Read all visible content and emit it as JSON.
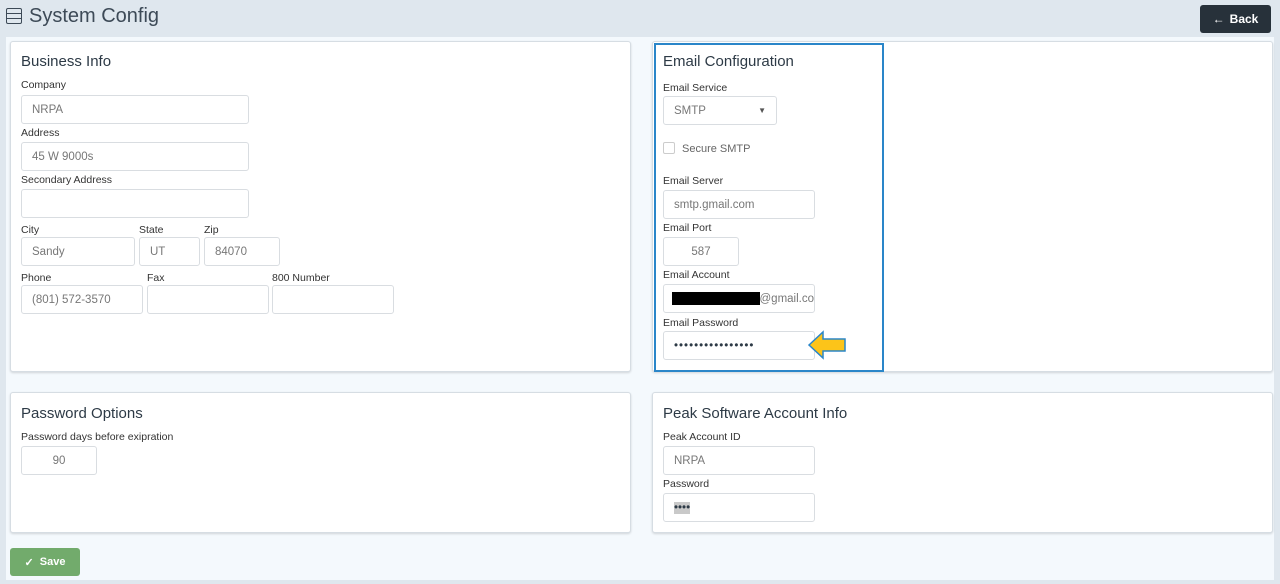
{
  "header": {
    "title": "System Config",
    "back_label": "Back"
  },
  "business": {
    "title": "Business Info",
    "company_label": "Company",
    "company": "NRPA",
    "address_label": "Address",
    "address": "45 W 9000s",
    "secondary_label": "Secondary Address",
    "secondary": "",
    "city_label": "City",
    "city": "Sandy",
    "state_label": "State",
    "state": "UT",
    "zip_label": "Zip",
    "zip": "84070",
    "phone_label": "Phone",
    "phone": "(801) 572-3570",
    "fax_label": "Fax",
    "fax": "",
    "toll_label": "800 Number",
    "toll": ""
  },
  "email": {
    "title": "Email Configuration",
    "service_label": "Email Service",
    "service": "SMTP",
    "secure_label": "Secure SMTP",
    "server_label": "Email Server",
    "server": "smtp.gmail.com",
    "port_label": "Email Port",
    "port": "587",
    "account_label": "Email Account",
    "account_suffix": "@gmail.co",
    "password_label": "Email Password",
    "password": "••••••••••••••••"
  },
  "password_options": {
    "title": "Password Options",
    "days_label": "Password days before exipration",
    "days": "90"
  },
  "peak": {
    "title": "Peak Software Account Info",
    "id_label": "Peak Account ID",
    "id": "NRPA",
    "password_label": "Password",
    "password": "••••"
  },
  "footer": {
    "save_label": "Save"
  },
  "colors": {
    "highlight": "#2a86c9",
    "save": "#72ab6c",
    "arrow": "#fcc419"
  }
}
